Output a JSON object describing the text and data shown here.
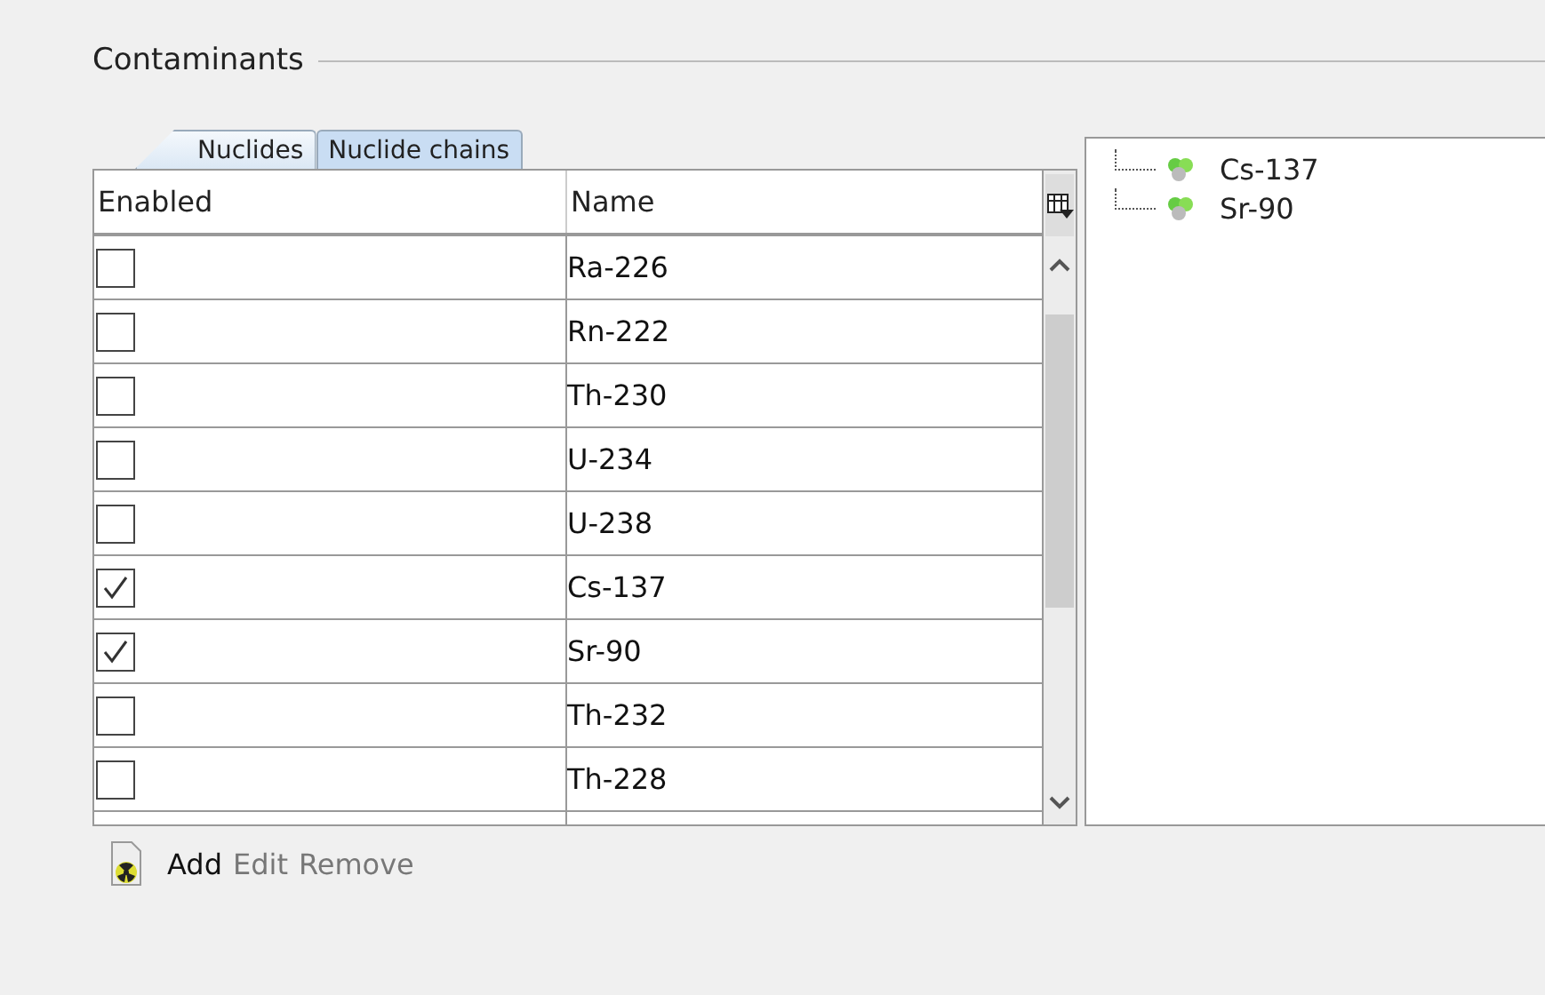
{
  "group": {
    "title": "Contaminants"
  },
  "tabs": [
    {
      "label": "Nuclides",
      "selected": true
    },
    {
      "label": "Nuclide chains",
      "selected": false
    }
  ],
  "table": {
    "columns": [
      "Enabled",
      "Name"
    ],
    "rows": [
      {
        "enabled": false,
        "name": "Ra-226"
      },
      {
        "enabled": false,
        "name": "Rn-222"
      },
      {
        "enabled": false,
        "name": "Th-230"
      },
      {
        "enabled": false,
        "name": "U-234"
      },
      {
        "enabled": false,
        "name": "U-238"
      },
      {
        "enabled": true,
        "name": "Cs-137"
      },
      {
        "enabled": true,
        "name": "Sr-90"
      },
      {
        "enabled": false,
        "name": "Th-232"
      },
      {
        "enabled": false,
        "name": "Th-228"
      }
    ]
  },
  "tree": {
    "items": [
      {
        "label": "Cs-137"
      },
      {
        "label": "Sr-90"
      }
    ]
  },
  "actions": [
    {
      "label": "Add",
      "disabled": false
    },
    {
      "label": "Edit",
      "disabled": true
    },
    {
      "label": "Remove",
      "disabled": true
    }
  ]
}
